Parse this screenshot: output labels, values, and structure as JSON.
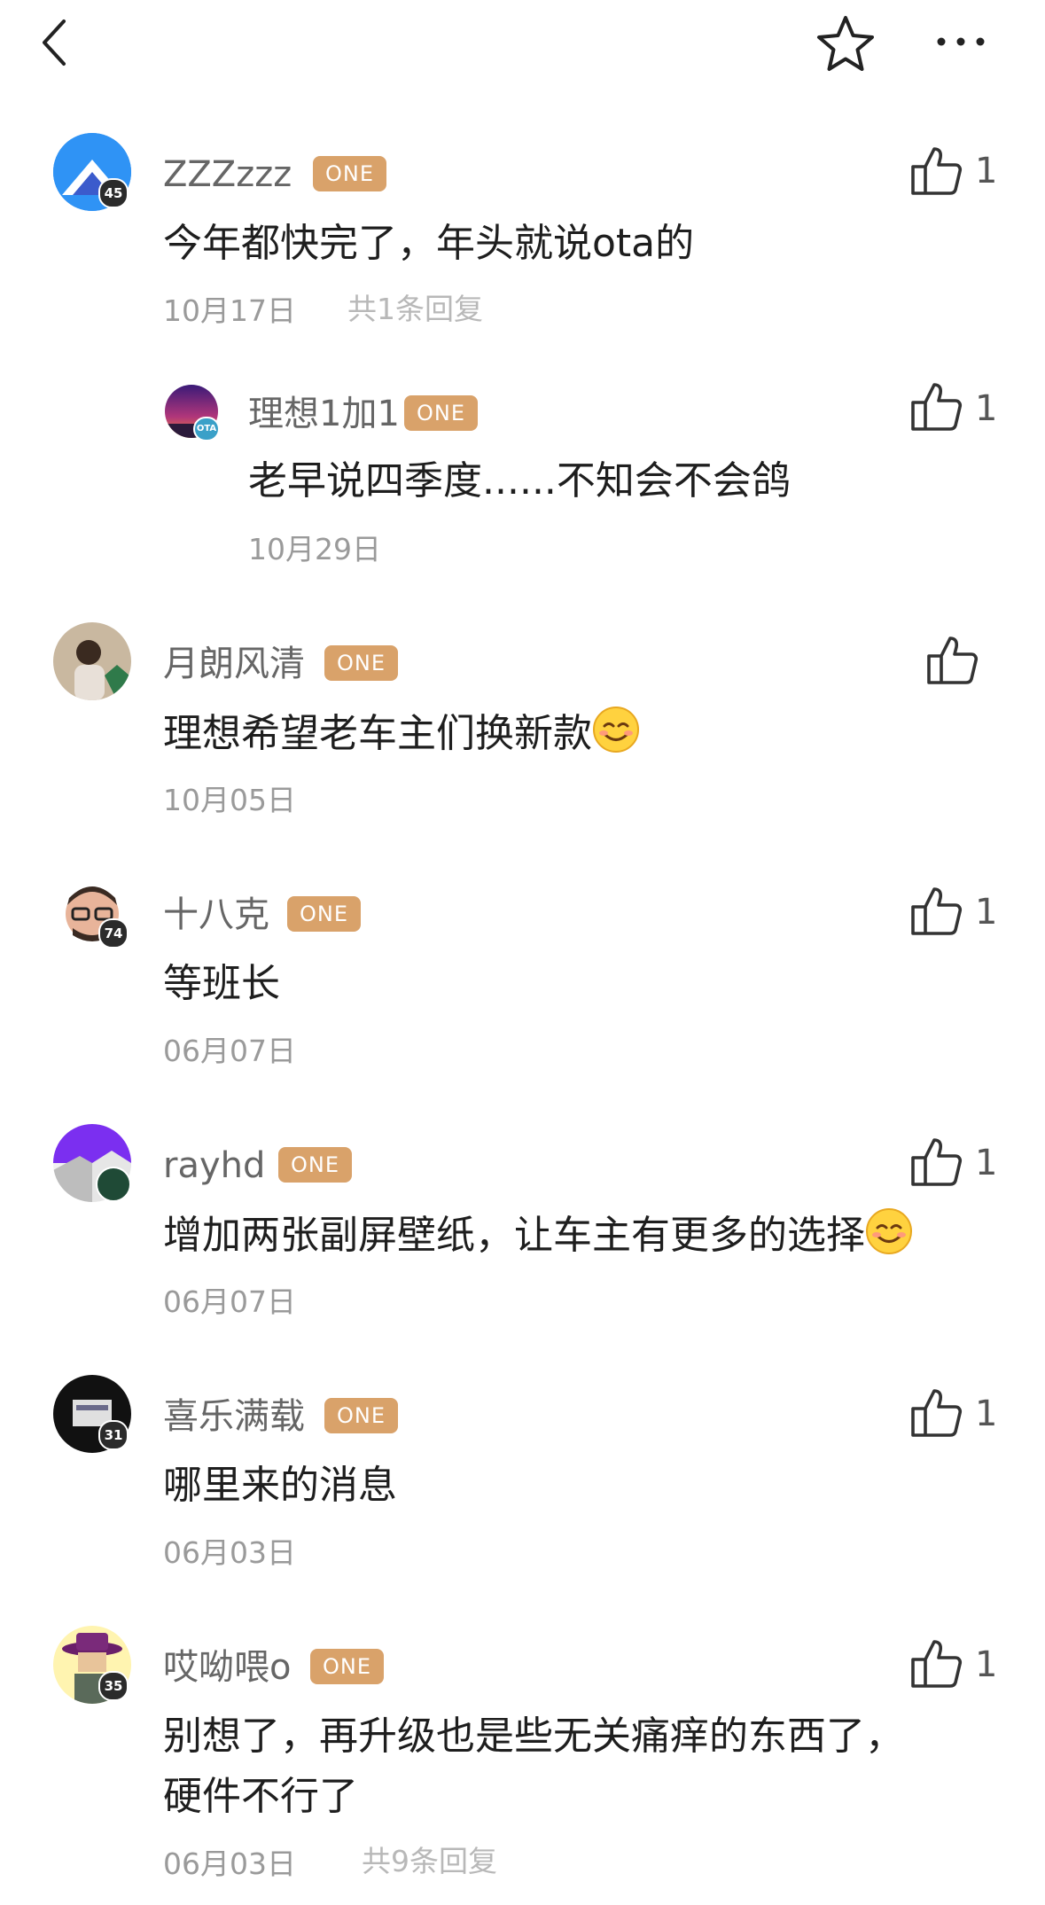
{
  "icons": {
    "back": "chevron-left-icon",
    "favorite": "star-outline-icon",
    "more": "more-dots-icon",
    "like": "thumbs-up-icon",
    "smile": "smiling-emoji-icon"
  },
  "colors": {
    "badge": "#d9a26a",
    "date": "#9a9a9a",
    "text": "#1e1e1e"
  },
  "comments": [
    {
      "user": "ZZZzzz",
      "badge": "ONE",
      "level": "45",
      "text": "今年都快完了，年头就说ota的",
      "date": "10月17日",
      "replies": "共1条回复",
      "likes": "1"
    },
    {
      "user": "理想1加1",
      "badge": "ONE",
      "level": "OTA",
      "text": "老早说四季度......不知会不会鸽",
      "date": "10月29日",
      "likes": "1",
      "is_reply": true
    },
    {
      "user": "月朗风清",
      "badge": "ONE",
      "text": "理想希望老车主们换新款",
      "date": "10月05日",
      "likes": ""
    },
    {
      "user": "十八克",
      "badge": "ONE",
      "level": "74",
      "text": "等班长",
      "date": "06月07日",
      "likes": "1"
    },
    {
      "user": "rayhd",
      "badge": "ONE",
      "text": "增加两张副屏壁纸，让车主有更多的选择",
      "date": "06月07日",
      "likes": "1"
    },
    {
      "user": "喜乐满载",
      "badge": "ONE",
      "level": "31",
      "text": "哪里来的消息",
      "date": "06月03日",
      "likes": "1"
    },
    {
      "user": "哎呦喂o",
      "badge": "ONE",
      "level": "35",
      "text_line1": "别想了，再升级也是些无关痛痒的东西了，",
      "text_line2": "硬件不行了",
      "date": "06月03日",
      "replies": "共9条回复",
      "likes": "1"
    }
  ]
}
